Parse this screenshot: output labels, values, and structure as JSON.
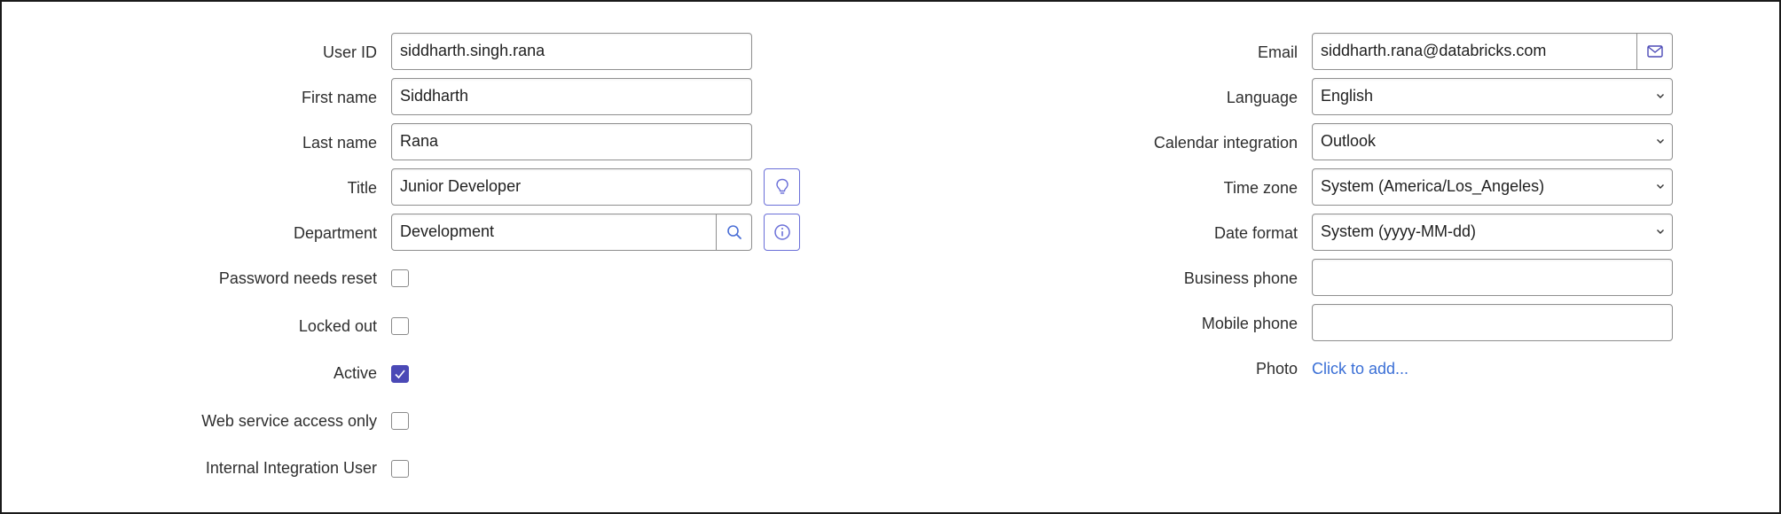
{
  "colors": {
    "accent": "#4b49b6",
    "icon_button_border": "#6a6fd8",
    "link": "#3a6fd6",
    "field_border": "#8f8f8f"
  },
  "left": {
    "user_id": {
      "label": "User ID",
      "value": "siddharth.singh.rana"
    },
    "first_name": {
      "label": "First name",
      "value": "Siddharth"
    },
    "last_name": {
      "label": "Last name",
      "value": "Rana"
    },
    "title": {
      "label": "Title",
      "value": "Junior Developer",
      "icon": "lightbulb-icon"
    },
    "department": {
      "label": "Department",
      "value": "Development",
      "search_icon": "search-icon",
      "info_icon": "info-icon"
    },
    "password_needs_reset": {
      "label": "Password needs reset",
      "checked": false
    },
    "locked_out": {
      "label": "Locked out",
      "checked": false
    },
    "active": {
      "label": "Active",
      "checked": true
    },
    "web_service_access_only": {
      "label": "Web service access only",
      "checked": false
    },
    "internal_integration_user": {
      "label": "Internal Integration User",
      "checked": false
    }
  },
  "right": {
    "email": {
      "label": "Email",
      "value": "siddharth.rana@databricks.com",
      "icon": "mail-icon"
    },
    "language": {
      "label": "Language",
      "value": "English"
    },
    "calendar_integration": {
      "label": "Calendar integration",
      "value": "Outlook"
    },
    "time_zone": {
      "label": "Time zone",
      "value": "System (America/Los_Angeles)"
    },
    "date_format": {
      "label": "Date format",
      "value": "System (yyyy-MM-dd)"
    },
    "business_phone": {
      "label": "Business phone",
      "value": ""
    },
    "mobile_phone": {
      "label": "Mobile phone",
      "value": ""
    },
    "photo": {
      "label": "Photo",
      "link_text": "Click to add..."
    }
  }
}
